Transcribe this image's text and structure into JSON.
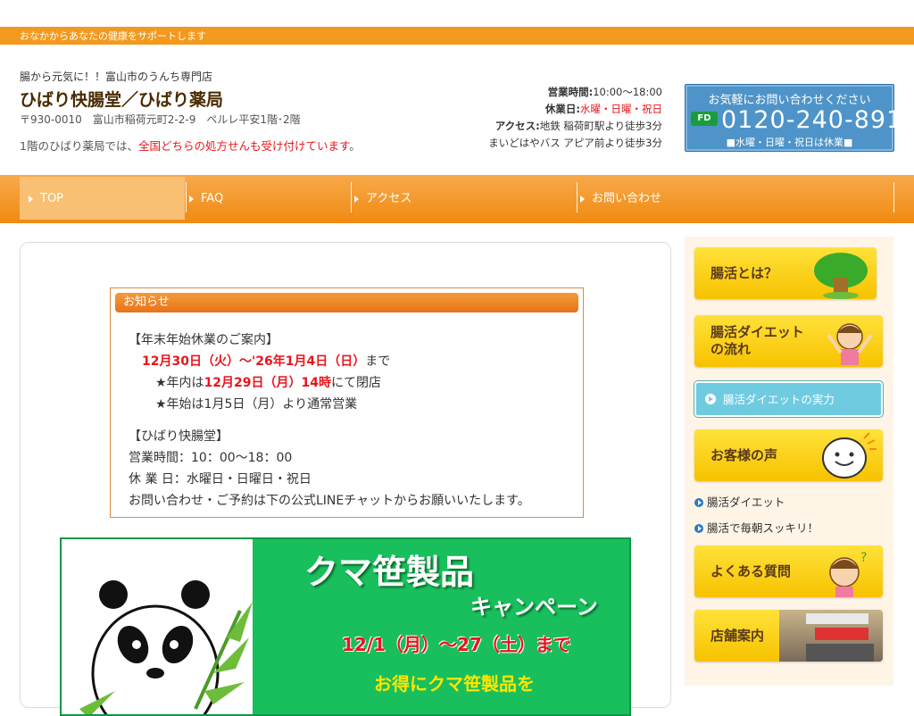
{
  "topbar": {
    "tagline": "おなかからあなたの健康をサポートします"
  },
  "header": {
    "subtitle": "腸から元気に！！富山市のうんち専門店",
    "title": "ひばり快腸堂／ひばり薬局",
    "address": "〒930-0010　富山市稲荷元町2-2-9　ペルレ平安1階･2階",
    "note_prefix": "1階のひばり薬局では、",
    "note_red": "全国どちらの処方せんも受け付けています",
    "note_suffix": "。"
  },
  "info": {
    "hours_label": "営業時間:",
    "hours_value": "10:00〜18:00",
    "closed_label": "休業日:",
    "closed_value": "水曜・日曜・祝日",
    "access_label": "アクセス:",
    "access_value": "地鉄 稲荷町駅より徒歩3分",
    "bus": "まいどはやバス アピア前より徒歩3分"
  },
  "callbox": {
    "line1": "お気軽にお問い合わせください",
    "freedial": "FD",
    "tel": "0120-240-891",
    "line3": "■水曜・日曜・祝日は休業■"
  },
  "nav": {
    "items": [
      {
        "label": "TOP"
      },
      {
        "label": "FAQ"
      },
      {
        "label": "アクセス"
      },
      {
        "label": "お問い合わせ"
      }
    ]
  },
  "notice": {
    "header": "お知らせ",
    "l1": "【年末年始休業のご案内】",
    "l2_red": "12月30日（火）〜'26年1月4日（日）",
    "l2_suffix": "まで",
    "l3_prefix": "★年内は",
    "l3_red": "12月29日（月）14時",
    "l3_suffix": "にて閉店",
    "l4": "★年始は1月5日（月）より通常営業",
    "l5": "【ひばり快腸堂】",
    "l6": "営業時間：10：00〜18：00",
    "l7": "休 業 日：水曜日・日曜日・祝日",
    "l8": "お問い合わせ・ご予約は下の公式LINEチャットからお願いいたします。"
  },
  "banner": {
    "title": "クマ笹製品",
    "campaign": "キャンペーン",
    "period": "12/1（月）〜27（土）まで",
    "more": "お得にクマ笹製品を"
  },
  "sidebar": {
    "btn1": "腸活とは？",
    "btn2": "腸活ダイエット\nの流れ",
    "btn3": "腸活ダイエットの実力",
    "btn4": "お客様の声",
    "link1": "腸活ダイエット",
    "link2": "腸活で毎朝スッキリ！",
    "btn5": "よくある質問",
    "btn6": "店舗案内"
  }
}
